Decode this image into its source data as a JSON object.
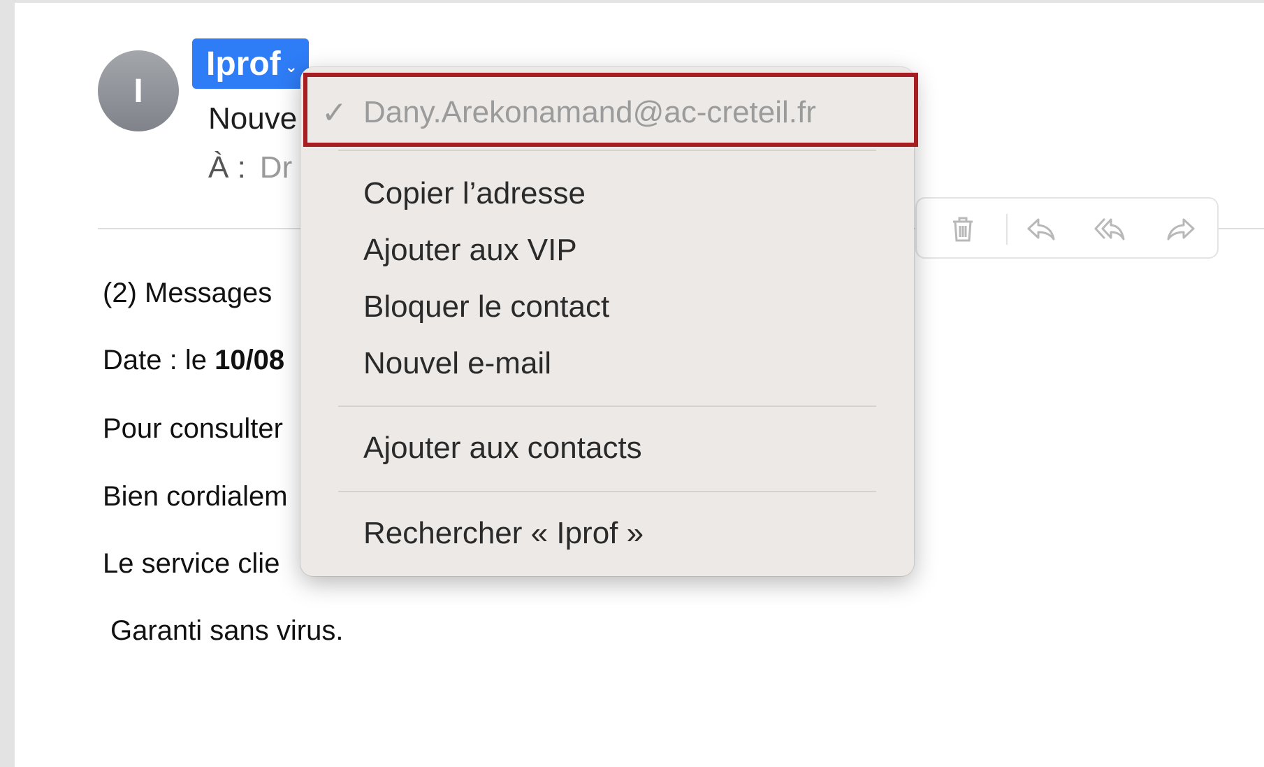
{
  "sender": {
    "avatar_initial": "I",
    "name": "Iprof",
    "chevron": "⌄"
  },
  "header": {
    "subject_partial": "Nouve",
    "to_label": "À :",
    "to_value_partial": "Dr"
  },
  "toolbar": {
    "icons": [
      "trash-icon",
      "reply-icon",
      "reply-all-icon",
      "forward-icon"
    ]
  },
  "body": {
    "line1": "(2) Messages",
    "line2_prefix": "Date : le ",
    "line2_bold": "10/08",
    "line3": "Pour consulter",
    "line4": "Bien cordialem",
    "line5": "Le service clie",
    "line6": "Garanti sans virus."
  },
  "context_menu": {
    "check": "✓",
    "email": "Dany.Arekonamand@ac-creteil.fr",
    "items": [
      "Copier l’adresse",
      "Ajouter aux VIP",
      "Bloquer le contact",
      "Nouvel e-mail"
    ],
    "add_contact": "Ajouter aux contacts",
    "search": "Rechercher « Iprof »"
  },
  "colors": {
    "accent": "#2e7cf6",
    "highlight": "#a61e22",
    "menu_bg": "#ece9e6"
  }
}
